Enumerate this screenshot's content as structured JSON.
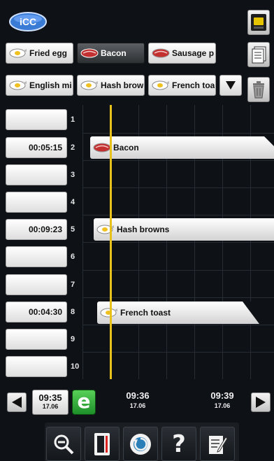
{
  "header": {
    "logo_text": "iCC",
    "top_icons": [
      "oven-display-icon",
      "recipe-list-icon",
      "trash-icon"
    ]
  },
  "products_row1": [
    {
      "label": "Fried egg",
      "icon": "egg-icon",
      "selected": false
    },
    {
      "label": "Bacon",
      "icon": "meat-icon",
      "selected": true
    },
    {
      "label": "Sausage p",
      "icon": "meat-icon",
      "selected": false
    }
  ],
  "products_row2": [
    {
      "label": "English mi",
      "icon": "egg-icon"
    },
    {
      "label": "Hash brow",
      "icon": "egg-icon"
    },
    {
      "label": "French toa",
      "icon": "egg-icon"
    }
  ],
  "slots": [
    {
      "num": "1",
      "timer": ""
    },
    {
      "num": "2",
      "timer": "00:05:15",
      "product": "Bacon",
      "icon": "meat-icon"
    },
    {
      "num": "3",
      "timer": ""
    },
    {
      "num": "4",
      "timer": ""
    },
    {
      "num": "5",
      "timer": "00:09:23",
      "product": "Hash browns",
      "icon": "egg-icon"
    },
    {
      "num": "6",
      "timer": ""
    },
    {
      "num": "7",
      "timer": ""
    },
    {
      "num": "8",
      "timer": "00:04:30",
      "product": "French toast",
      "icon": "egg-icon"
    },
    {
      "num": "9",
      "timer": ""
    },
    {
      "num": "10",
      "timer": ""
    }
  ],
  "timeline": {
    "current": {
      "time": "09:35",
      "date": "17.06"
    },
    "ticks": [
      {
        "time": "09:36",
        "date": "17.06"
      },
      {
        "time": "09:39",
        "date": "17.06"
      }
    ],
    "eco_label": "e"
  },
  "toolbar": {
    "icons": [
      "zoom-out-icon",
      "oven-icon",
      "rotate-icon",
      "help-icon",
      "notes-icon"
    ],
    "help_label": "?"
  },
  "colors": {
    "now_line": "#e8c21a",
    "selected_chip": "#3b3e42",
    "eco_green": "#2ea23a",
    "background": "#0e1116"
  }
}
